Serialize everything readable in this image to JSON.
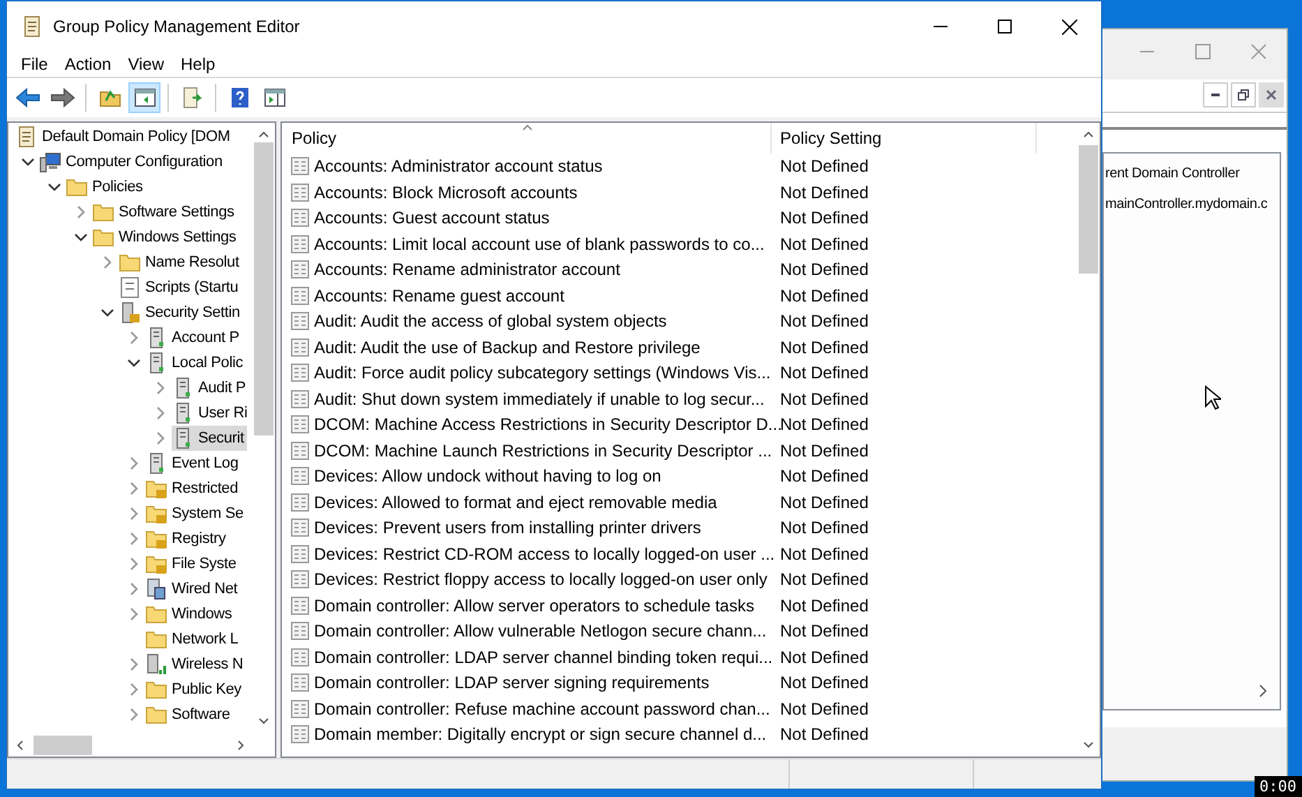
{
  "window": {
    "title": "Group Policy Management Editor"
  },
  "menu": [
    "File",
    "Action",
    "View",
    "Help"
  ],
  "toolbar": [
    {
      "kind": "back",
      "pressed": false
    },
    {
      "kind": "forward",
      "pressed": false
    },
    {
      "kind": "sep"
    },
    {
      "kind": "up",
      "pressed": false
    },
    {
      "kind": "tree",
      "pressed": true
    },
    {
      "kind": "sep"
    },
    {
      "kind": "export",
      "pressed": false
    },
    {
      "kind": "sep"
    },
    {
      "kind": "help",
      "pressed": false
    },
    {
      "kind": "pane",
      "pressed": false
    }
  ],
  "tree": [
    {
      "label": "Default Domain Policy [DOM",
      "kind": "scroll",
      "selected": false,
      "children": [
        {
          "label": "Computer Configuration",
          "kind": "computer",
          "expanded": true,
          "selected": false,
          "children": [
            {
              "label": "Policies",
              "kind": "folder",
              "expanded": true,
              "selected": false,
              "children": [
                {
                  "label": "Software Settings",
                  "kind": "folder",
                  "expanded": false,
                  "selected": false
                },
                {
                  "label": "Windows Settings",
                  "kind": "folder",
                  "expanded": true,
                  "selected": false,
                  "children": [
                    {
                      "label": "Name Resolut",
                      "kind": "folder",
                      "expanded": false,
                      "selected": false
                    },
                    {
                      "label": "Scripts (Startu",
                      "kind": "script",
                      "selected": false
                    },
                    {
                      "label": "Security Settin",
                      "kind": "secure",
                      "expanded": true,
                      "selected": false,
                      "children": [
                        {
                          "label": "Account P",
                          "kind": "server",
                          "expanded": false,
                          "selected": false
                        },
                        {
                          "label": "Local Polic",
                          "kind": "server",
                          "expanded": true,
                          "selected": false,
                          "children": [
                            {
                              "label": "Audit P",
                              "kind": "server",
                              "expanded": false,
                              "selected": false
                            },
                            {
                              "label": "User Ri",
                              "kind": "server",
                              "expanded": false,
                              "selected": false
                            },
                            {
                              "label": "Securit",
                              "kind": "server",
                              "expanded": false,
                              "selected": true
                            }
                          ]
                        },
                        {
                          "label": "Event Log",
                          "kind": "server",
                          "expanded": false,
                          "selected": false
                        },
                        {
                          "label": "Restricted",
                          "kind": "locked",
                          "expanded": false,
                          "selected": false
                        },
                        {
                          "label": "System Se",
                          "kind": "locked",
                          "expanded": false,
                          "selected": false
                        },
                        {
                          "label": "Registry",
                          "kind": "locked",
                          "expanded": false,
                          "selected": false
                        },
                        {
                          "label": "File Syste",
                          "kind": "locked",
                          "expanded": false,
                          "selected": false
                        },
                        {
                          "label": "Wired Net",
                          "kind": "network",
                          "expanded": false,
                          "selected": false
                        },
                        {
                          "label": "Windows",
                          "kind": "folder",
                          "expanded": false,
                          "selected": false
                        },
                        {
                          "label": "Network L",
                          "kind": "folder",
                          "selected": false
                        },
                        {
                          "label": "Wireless N",
                          "kind": "wireless",
                          "expanded": false,
                          "selected": false
                        },
                        {
                          "label": "Public Key",
                          "kind": "folder",
                          "expanded": false,
                          "selected": false
                        },
                        {
                          "label": "Software",
                          "kind": "folder",
                          "expanded": false,
                          "selected": false
                        }
                      ]
                    }
                  ]
                }
              ]
            }
          ]
        }
      ]
    }
  ],
  "table": {
    "columns": [
      "Policy",
      "Policy Setting"
    ],
    "rows": [
      [
        "Accounts: Administrator account status",
        "Not Defined"
      ],
      [
        "Accounts: Block Microsoft accounts",
        "Not Defined"
      ],
      [
        "Accounts: Guest account status",
        "Not Defined"
      ],
      [
        "Accounts: Limit local account use of blank passwords to co...",
        "Not Defined"
      ],
      [
        "Accounts: Rename administrator account",
        "Not Defined"
      ],
      [
        "Accounts: Rename guest account",
        "Not Defined"
      ],
      [
        "Audit: Audit the access of global system objects",
        "Not Defined"
      ],
      [
        "Audit: Audit the use of Backup and Restore privilege",
        "Not Defined"
      ],
      [
        "Audit: Force audit policy subcategory settings (Windows Vis...",
        "Not Defined"
      ],
      [
        "Audit: Shut down system immediately if unable to log secur...",
        "Not Defined"
      ],
      [
        "DCOM: Machine Access Restrictions in Security Descriptor D...",
        "Not Defined"
      ],
      [
        "DCOM: Machine Launch Restrictions in Security Descriptor ...",
        "Not Defined"
      ],
      [
        "Devices: Allow undock without having to log on",
        "Not Defined"
      ],
      [
        "Devices: Allowed to format and eject removable media",
        "Not Defined"
      ],
      [
        "Devices: Prevent users from installing printer drivers",
        "Not Defined"
      ],
      [
        "Devices: Restrict CD-ROM access to locally logged-on user ...",
        "Not Defined"
      ],
      [
        "Devices: Restrict floppy access to locally logged-on user only",
        "Not Defined"
      ],
      [
        "Domain controller: Allow server operators to schedule tasks",
        "Not Defined"
      ],
      [
        "Domain controller: Allow vulnerable Netlogon secure chann...",
        "Not Defined"
      ],
      [
        "Domain controller: LDAP server channel binding token requi...",
        "Not Defined"
      ],
      [
        "Domain controller: LDAP server signing requirements",
        "Not Defined"
      ],
      [
        "Domain controller: Refuse machine account password chan...",
        "Not Defined"
      ],
      [
        "Domain member: Digitally encrypt or sign secure channel d...",
        "Not Defined"
      ]
    ]
  },
  "back_window": {
    "lines": [
      "rent Domain Controller",
      "mainController.mydomain.c"
    ]
  },
  "timer": "0:00"
}
